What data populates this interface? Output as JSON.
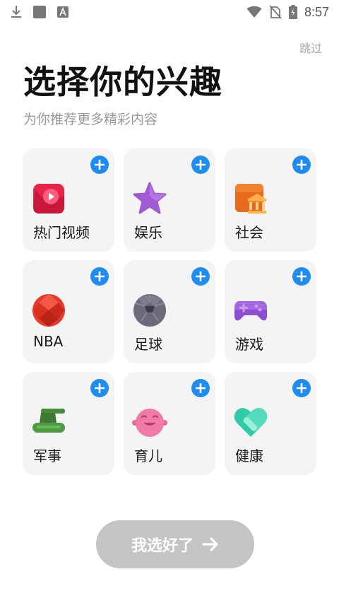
{
  "status_bar": {
    "time": "8:57",
    "left_icons": [
      "download-icon",
      "square-notification-icon",
      "text-notification-icon"
    ],
    "right_icons": [
      "wifi-icon",
      "no-sim-icon",
      "battery-charging-icon"
    ]
  },
  "header": {
    "skip_label": "跳过",
    "title": "选择你的兴趣",
    "subtitle": "为你推荐更多精彩内容"
  },
  "interests": [
    {
      "label": "热门视频",
      "icon": "video-icon"
    },
    {
      "label": "娱乐",
      "icon": "star-icon"
    },
    {
      "label": "社会",
      "icon": "building-icon"
    },
    {
      "label": "NBA",
      "icon": "basketball-icon"
    },
    {
      "label": "足球",
      "icon": "football-icon"
    },
    {
      "label": "游戏",
      "icon": "gamepad-icon"
    },
    {
      "label": "军事",
      "icon": "tank-icon"
    },
    {
      "label": "育儿",
      "icon": "baby-icon"
    },
    {
      "label": "健康",
      "icon": "heart-icon"
    }
  ],
  "confirm_button": {
    "label": "我选好了"
  },
  "colors": {
    "accent": "#1f8cf0",
    "card_bg": "#f4f4f4",
    "button_disabled": "#c4c4c4"
  }
}
